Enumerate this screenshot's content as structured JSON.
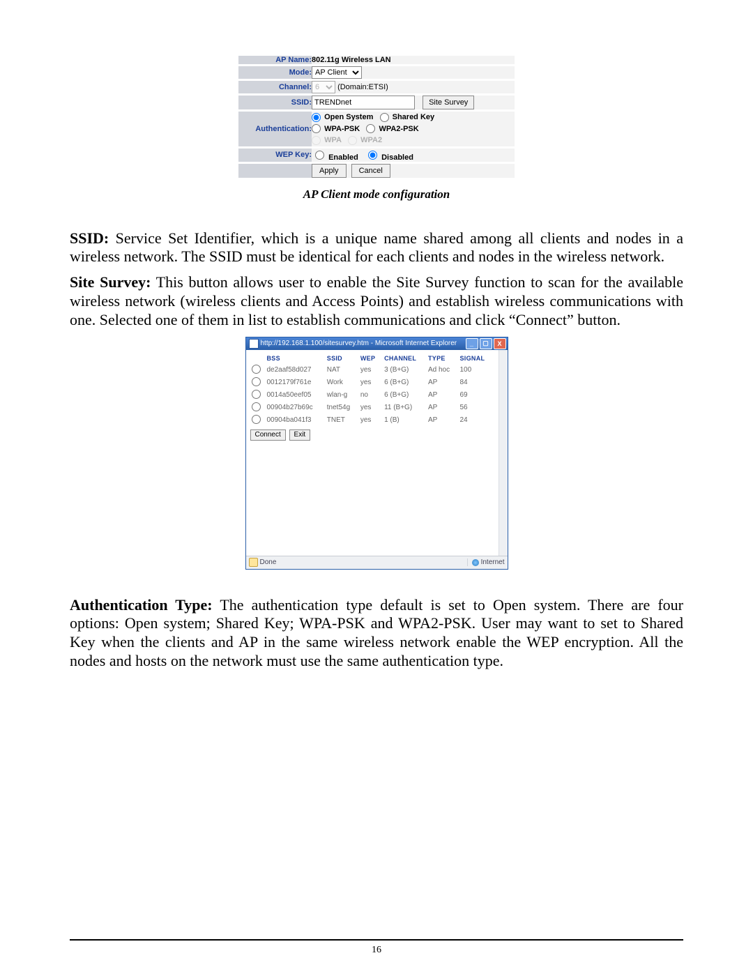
{
  "config": {
    "ap_name_label": "AP Name:",
    "ap_name_value": "802.11g Wireless LAN",
    "mode_label": "Mode:",
    "mode_value": "AP Client",
    "channel_label": "Channel:",
    "channel_value": "6",
    "channel_domain": "(Domain:ETSI)",
    "ssid_label": "SSID:",
    "ssid_value": "TRENDnet",
    "site_survey_button": "Site Survey",
    "auth_label": "Authentication:",
    "auth_open": "Open System",
    "auth_shared": "Shared Key",
    "auth_wpapsk": "WPA-PSK",
    "auth_wpa2psk": "WPA2-PSK",
    "auth_wpa": "WPA",
    "auth_wpa2": "WPA2",
    "wep_label": "WEP Key:",
    "wep_enabled": "Enabled",
    "wep_disabled": "Disabled",
    "apply": "Apply",
    "cancel": "Cancel"
  },
  "caption": "AP Client mode configuration",
  "para_ssid_b": "SSID:",
  "para_ssid": " Service Set Identifier, which is a unique name shared among all clients and nodes in a wireless network. The SSID must be identical for each clients and nodes in the wireless network.",
  "para_site_b": "Site Survey:",
  "para_site": " This button allows user to enable the Site Survey function to scan for the available wireless network (wireless clients and Access Points) and establish wireless communications with one. Selected one of them in list to establish communications and click “Connect” button.",
  "ie": {
    "title": "http://192.168.1.100/sitesurvey.htm - Microsoft Internet Explorer",
    "status_done": "Done",
    "status_zone": "Internet",
    "th_bss": "BSS",
    "th_ssid": "SSID",
    "th_wep": "WEP",
    "th_channel": "CHANNEL",
    "th_type": "TYPE",
    "th_signal": "SIGNAL",
    "rows": [
      {
        "bss": "de2aaf58d027",
        "ssid": "NAT",
        "wep": "yes",
        "ch": "3 (B+G)",
        "type": "Ad hoc",
        "sig": "100"
      },
      {
        "bss": "0012179f761e",
        "ssid": "Work",
        "wep": "yes",
        "ch": "6 (B+G)",
        "type": "AP",
        "sig": "84"
      },
      {
        "bss": "0014a50eef05",
        "ssid": "wlan-g",
        "wep": "no",
        "ch": "6 (B+G)",
        "type": "AP",
        "sig": "69"
      },
      {
        "bss": "00904b27b69c",
        "ssid": "tnet54g",
        "wep": "yes",
        "ch": "11 (B+G)",
        "type": "AP",
        "sig": "56"
      },
      {
        "bss": "00904ba041f3",
        "ssid": "TNET",
        "wep": "yes",
        "ch": "1 (B)",
        "type": "AP",
        "sig": "24"
      }
    ],
    "connect": "Connect",
    "exit": "Exit"
  },
  "para_auth_b": "Authentication Type:",
  "para_auth": " The authentication type default is set to Open system. There are four options: Open system; Shared Key; WPA-PSK and WPA2-PSK. User may want to set to Shared Key when the clients and AP in the same wireless network enable the WEP encryption. All the nodes and hosts on the network must use the same authentication type.",
  "page_number": "16"
}
